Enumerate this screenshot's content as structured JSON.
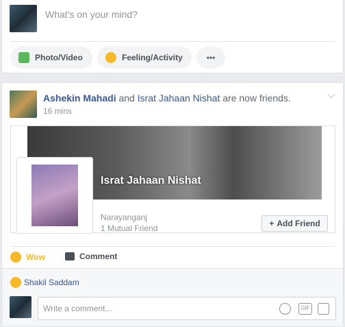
{
  "composer": {
    "placeholder": "What's on your mind?",
    "photo_label": "Photo/Video",
    "feeling_label": "Feeling/Activity",
    "more_label": "•••"
  },
  "story": {
    "actor": "Ashekin Mahadi",
    "connector": " and ",
    "friend": "Israt Jahaan Nishat",
    "suffix": " are now friends.",
    "time": "16 mins",
    "card": {
      "name": "Israt Jahaan Nishat",
      "location": "Narayanganj",
      "mutual": "1 Mutual Friend",
      "add_friend": "Add Friend"
    },
    "actions": {
      "wow": "Wow",
      "comment": "Comment"
    },
    "reactor": "Shakil Saddam",
    "comment_placeholder": "Write a comment...",
    "gif_label": "GIF"
  },
  "colors": {
    "link": "#365899",
    "wow": "#f7b928",
    "photo_green": "#44bec7"
  }
}
